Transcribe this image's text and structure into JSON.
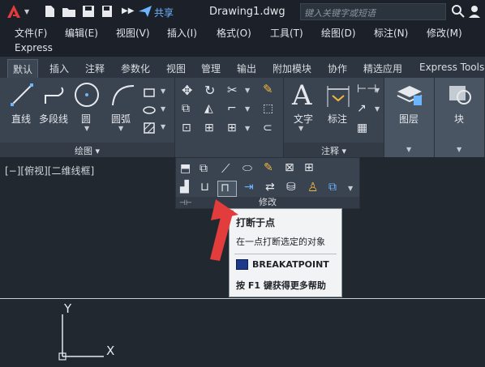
{
  "titlebar": {
    "file_name": "Drawing1.dwg",
    "share_label": "共享",
    "search_placeholder": "键入关键字或短语"
  },
  "menubar": {
    "items": [
      "文件(F)",
      "编辑(E)",
      "视图(V)",
      "插入(I)",
      "格式(O)",
      "工具(T)",
      "绘图(D)",
      "标注(N)",
      "修改(M)"
    ],
    "second_row": "Express"
  },
  "ribbon_tabs": [
    "默认",
    "插入",
    "注释",
    "参数化",
    "视图",
    "管理",
    "输出",
    "附加模块",
    "协作",
    "精选应用",
    "Express Tools"
  ],
  "ribbon": {
    "draw_panel": {
      "title": "绘图",
      "tools": [
        "直线",
        "多段线",
        "圆",
        "圆弧"
      ]
    },
    "annotation_panel": {
      "title": "注释",
      "tools": [
        "文字",
        "标注"
      ]
    },
    "layers_label": "图层",
    "block_label": "块"
  },
  "viewport_label": "[−][俯视][二维线框]",
  "modify_panel": {
    "title": "修改"
  },
  "tooltip": {
    "title": "打断于点",
    "description": "在一点打断选定的对象",
    "command": "BREAKATPOINT",
    "help": "按 F1 键获得更多帮助"
  },
  "ucs": {
    "x_label": "X",
    "y_label": "Y"
  },
  "colors": {
    "accent": "#e23c3c",
    "share": "#6cb6ff",
    "background": "#212830"
  }
}
